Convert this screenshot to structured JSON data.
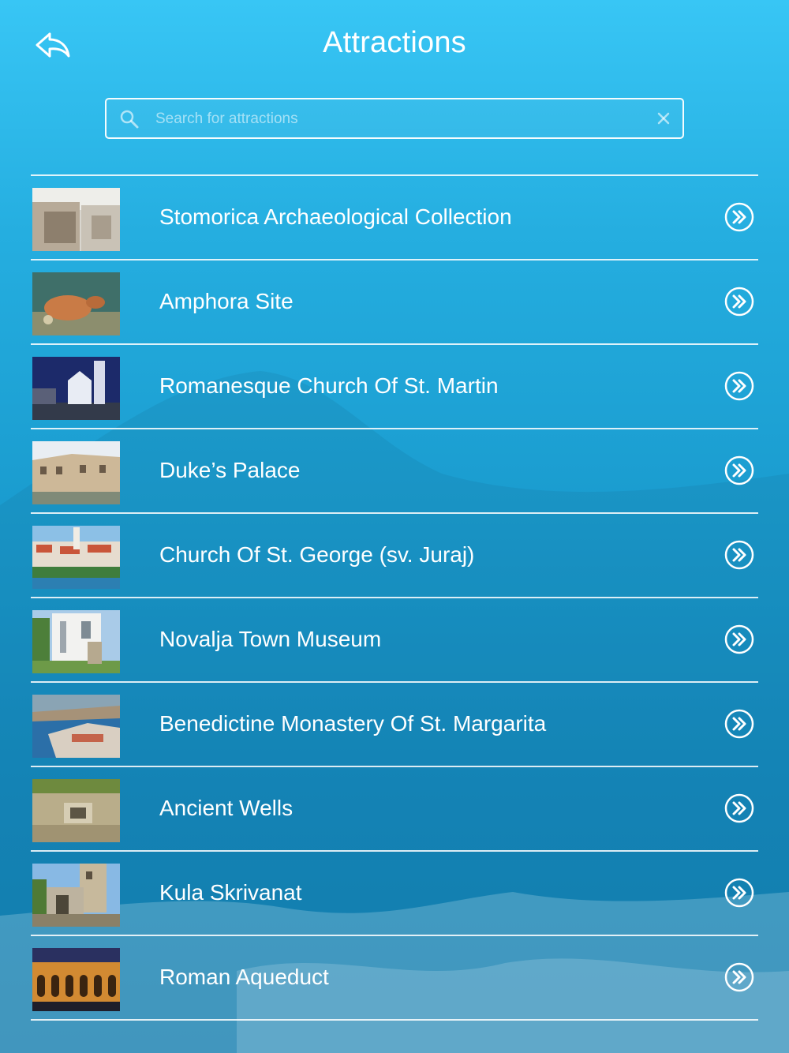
{
  "header": {
    "title": "Attractions"
  },
  "search": {
    "placeholder": "Search for attractions",
    "value": ""
  },
  "attractions": [
    {
      "label": "Stomorica Archaeological Collection"
    },
    {
      "label": "Amphora Site"
    },
    {
      "label": "Romanesque Church Of St. Martin"
    },
    {
      "label": "Duke’s Palace"
    },
    {
      "label": "Church Of St. George (sv. Juraj)"
    },
    {
      "label": "Novalja Town Museum"
    },
    {
      "label": "Benedictine Monastery Of St. Margarita"
    },
    {
      "label": "Ancient Wells"
    },
    {
      "label": "Kula Skrivanat"
    },
    {
      "label": "Roman Aqueduct"
    }
  ],
  "colors": {
    "background_top": "#38c6f5",
    "background_bottom": "#127fb2",
    "foreground": "#ffffff"
  },
  "icons": {
    "back": "back-arrow-icon",
    "search": "search-icon",
    "clear": "close-icon",
    "row_action": "double-chevron-right-circle-icon"
  }
}
